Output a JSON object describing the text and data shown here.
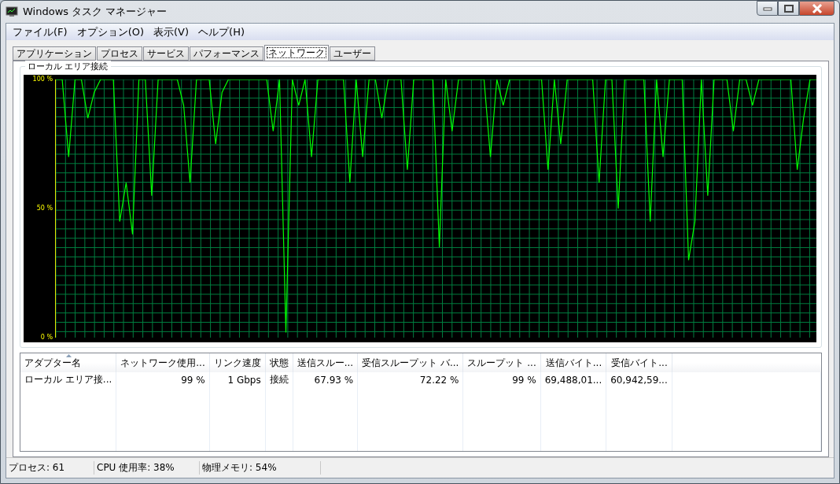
{
  "window": {
    "title": "Windows タスク マネージャー"
  },
  "menu": [
    "ファイル(F)",
    "オプション(O)",
    "表示(V)",
    "ヘルプ(H)"
  ],
  "tabs": [
    {
      "label": "アプリケーション",
      "selected": false
    },
    {
      "label": "プロセス",
      "selected": false
    },
    {
      "label": "サービス",
      "selected": false
    },
    {
      "label": "パフォーマンス",
      "selected": false
    },
    {
      "label": "ネットワーク",
      "selected": true
    },
    {
      "label": "ユーザー",
      "selected": false
    }
  ],
  "graph": {
    "title": "ローカル エリア接続",
    "chart_data": {
      "type": "line",
      "ylim": [
        0,
        100
      ],
      "yticks": [
        {
          "value": 100,
          "label": "100 %"
        },
        {
          "value": 50,
          "label": "50 %"
        },
        {
          "value": 0,
          "label": "0 %"
        }
      ],
      "series": [
        {
          "color": "#00ff00",
          "values": [
            100,
            100,
            70,
            100,
            100,
            85,
            95,
            100,
            100,
            100,
            45,
            60,
            40,
            100,
            100,
            55,
            100,
            100,
            100,
            100,
            90,
            60,
            100,
            100,
            100,
            75,
            95,
            100,
            100,
            100,
            100,
            100,
            100,
            100,
            80,
            100,
            2,
            100,
            90,
            100,
            70,
            100,
            100,
            100,
            100,
            100,
            60,
            100,
            70,
            100,
            100,
            85,
            100,
            100,
            100,
            65,
            100,
            100,
            100,
            100,
            35,
            100,
            80,
            100,
            100,
            100,
            100,
            100,
            70,
            100,
            90,
            100,
            100,
            100,
            100,
            100,
            100,
            65,
            100,
            75,
            100,
            100,
            100,
            100,
            100,
            60,
            100,
            100,
            50,
            100,
            100,
            100,
            100,
            45,
            100,
            70,
            100,
            100,
            100,
            30,
            45,
            100,
            55,
            100,
            100,
            100,
            80,
            100,
            100,
            90,
            100,
            100,
            100,
            100,
            100,
            100,
            65,
            85,
            100,
            100
          ]
        }
      ]
    }
  },
  "table": {
    "columns": [
      {
        "label": "アダプター名",
        "sorted": true
      },
      {
        "label": "ネットワーク使用...",
        "sorted": false
      },
      {
        "label": "リンク速度",
        "sorted": false
      },
      {
        "label": "状態",
        "sorted": false
      },
      {
        "label": "送信スルー...",
        "sorted": false
      },
      {
        "label": "受信スループット バ...",
        "sorted": false
      },
      {
        "label": "スループット ...",
        "sorted": false
      },
      {
        "label": "送信バイト...",
        "sorted": false
      },
      {
        "label": "受信バイト...",
        "sorted": false
      }
    ],
    "rows": [
      [
        "ローカル エリア接...",
        "99 %",
        "1 Gbps",
        "接続",
        "67.93 %",
        "72.22 %",
        "99 %",
        "69,488,01...",
        "60,942,59..."
      ]
    ]
  },
  "status_bar": [
    "プロセス: 61",
    "CPU 使用率: 38%",
    "物理メモリ: 54%"
  ]
}
